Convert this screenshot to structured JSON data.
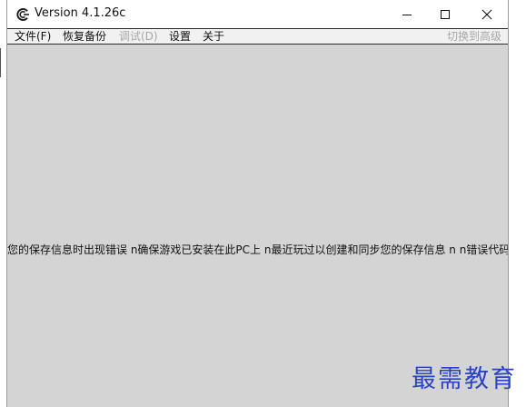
{
  "window": {
    "title": "Version 4.1.26c",
    "icon": "app-logo-icon"
  },
  "menubar": {
    "items": [
      {
        "label": "文件(F)",
        "enabled": true
      },
      {
        "label": "恢复备份",
        "enabled": true
      },
      {
        "label": "调试(D)",
        "enabled": false
      },
      {
        "label": "设置",
        "enabled": true
      },
      {
        "label": "关于",
        "enabled": true
      }
    ],
    "right_link": "切换到高级"
  },
  "content": {
    "message": "您的保存信息时出现错误 n确保游戏已安装在此PC上 n最近玩过以创建和同步您的保存信息 n  n错误代码"
  },
  "watermark": {
    "text": "最需教育",
    "color": "#2a43c4"
  },
  "colors": {
    "content_bg": "#d4d4d4",
    "disabled_text": "#a8a8a8"
  }
}
